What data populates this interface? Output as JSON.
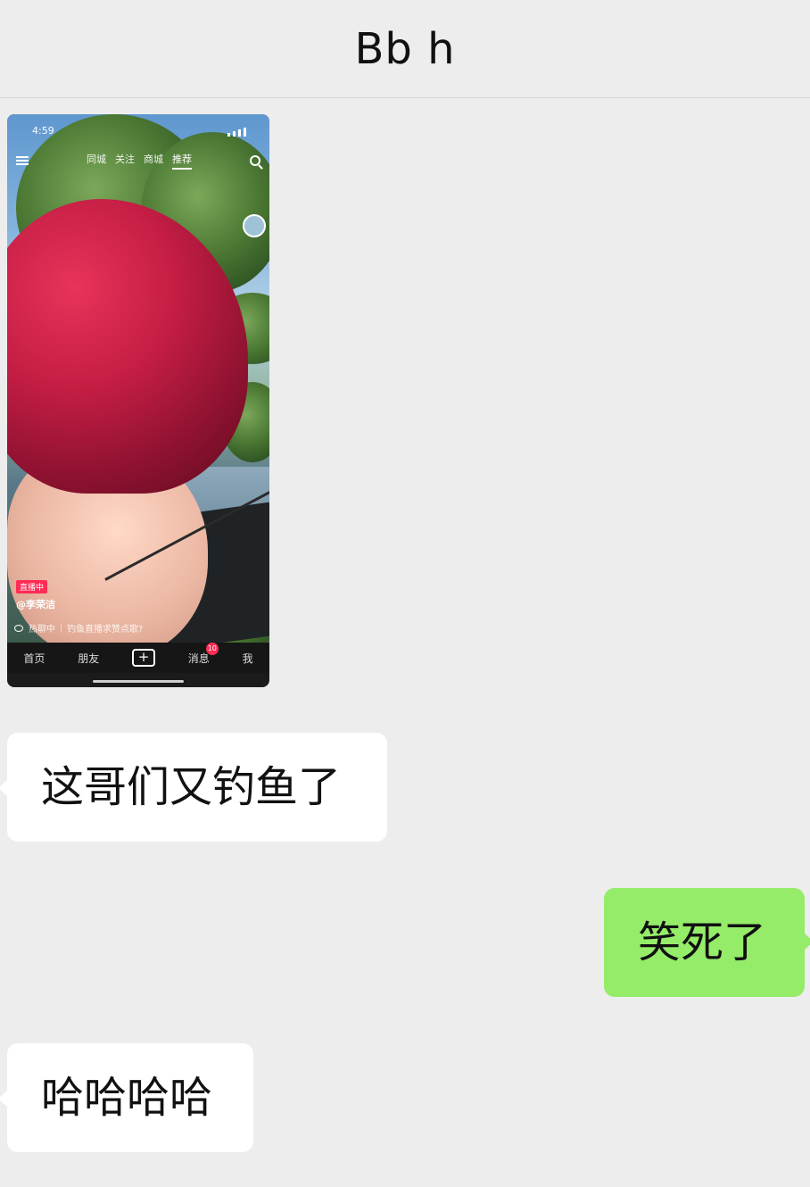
{
  "header": {
    "title": "Bb h"
  },
  "shared_screenshot": {
    "status_time": "4:59",
    "top_tabs": [
      "同城",
      "关注",
      "商城",
      "推荐"
    ],
    "active_tab": "推荐",
    "live_badge": "直播中",
    "author": "@李荣洁",
    "live_hot": "热聊中",
    "live_topic": "钓鱼直播求赞点歌?",
    "bottom_nav": [
      "首页",
      "朋友",
      "消息",
      "我"
    ],
    "message_badge": "10"
  },
  "messages": [
    {
      "side": "left",
      "text": "这哥们又钓鱼了"
    },
    {
      "side": "right",
      "text": "笑死了"
    },
    {
      "side": "left",
      "text": "哈哈哈哈"
    }
  ],
  "colors": {
    "background": "#ededed",
    "incoming_bubble": "#ffffff",
    "outgoing_bubble": "#95ec69",
    "badge": "#fe2c55"
  }
}
